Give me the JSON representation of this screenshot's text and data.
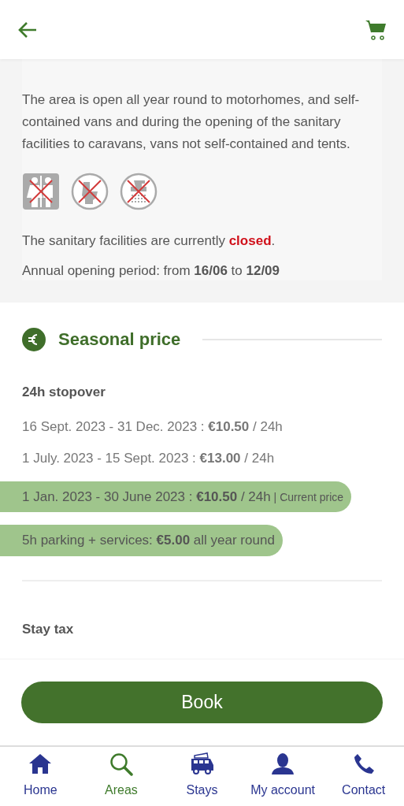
{
  "sanitary": {
    "description": "The area is open all year round to motorhomes, and self-contained vans and during the opening of the sanitary facilities to caravans, vans not self-contained and tents.",
    "facilities": [
      {
        "kind": "restrooms",
        "available": false
      },
      {
        "kind": "toilet",
        "available": false
      },
      {
        "kind": "shower",
        "available": false
      }
    ],
    "status": {
      "before": "The sanitary facilities are currently",
      "state": "closed",
      "after": ".",
      "open": false
    },
    "period": "Annual opening period: from **16/06** to **12/09**"
  },
  "seasonal_price": {
    "title": "Seasonal price",
    "group": "24h stopover",
    "prices": [
      {
        "text": "16 Sept. 2023 - 31 Dec. 2023 : **€10.50** / 24h",
        "highlighted": false
      },
      {
        "text": "1 July. 2023 - 15 Sept. 2023 : **€13.00** / 24h",
        "highlighted": false
      },
      {
        "text": "1 Jan. 2023 - 30 June 2023 : **€10.50** / 24h",
        "highlighted": true,
        "separator": "|",
        "note": "Current price"
      },
      {
        "text": "5h parking + services: **€5.00**  all year round",
        "highlighted": true
      }
    ],
    "tax_title": "Stay tax"
  },
  "book_button": "Book",
  "nav": [
    {
      "label": "Home",
      "kind": "home",
      "selected": false
    },
    {
      "label": "Areas",
      "kind": "search",
      "selected": true
    },
    {
      "label": "Stays",
      "kind": "van",
      "selected": false
    },
    {
      "label": "My account",
      "kind": "user",
      "selected": false
    },
    {
      "label": "Contact",
      "kind": "phone",
      "selected": false
    }
  ]
}
